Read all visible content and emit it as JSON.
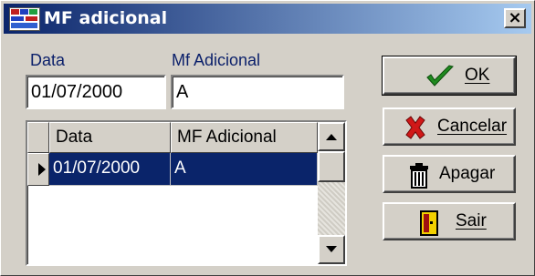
{
  "window": {
    "title": "MF adicional",
    "close_label": "×"
  },
  "form": {
    "data_label": "Data",
    "data_value": "01/07/2000",
    "mf_label": "Mf Adicional",
    "mf_value": "A"
  },
  "grid": {
    "columns": [
      "Data",
      "MF Adicional"
    ],
    "rows": [
      {
        "data": "01/07/2000",
        "mf": "A",
        "selected": true
      }
    ]
  },
  "buttons": {
    "ok": "OK",
    "cancel": "Cancelar",
    "delete": "Apagar",
    "exit": "Sair"
  },
  "colors": {
    "title_start": "#0a246a",
    "title_end": "#a6caf0",
    "selection": "#0a246a",
    "face": "#d4d0c8"
  }
}
